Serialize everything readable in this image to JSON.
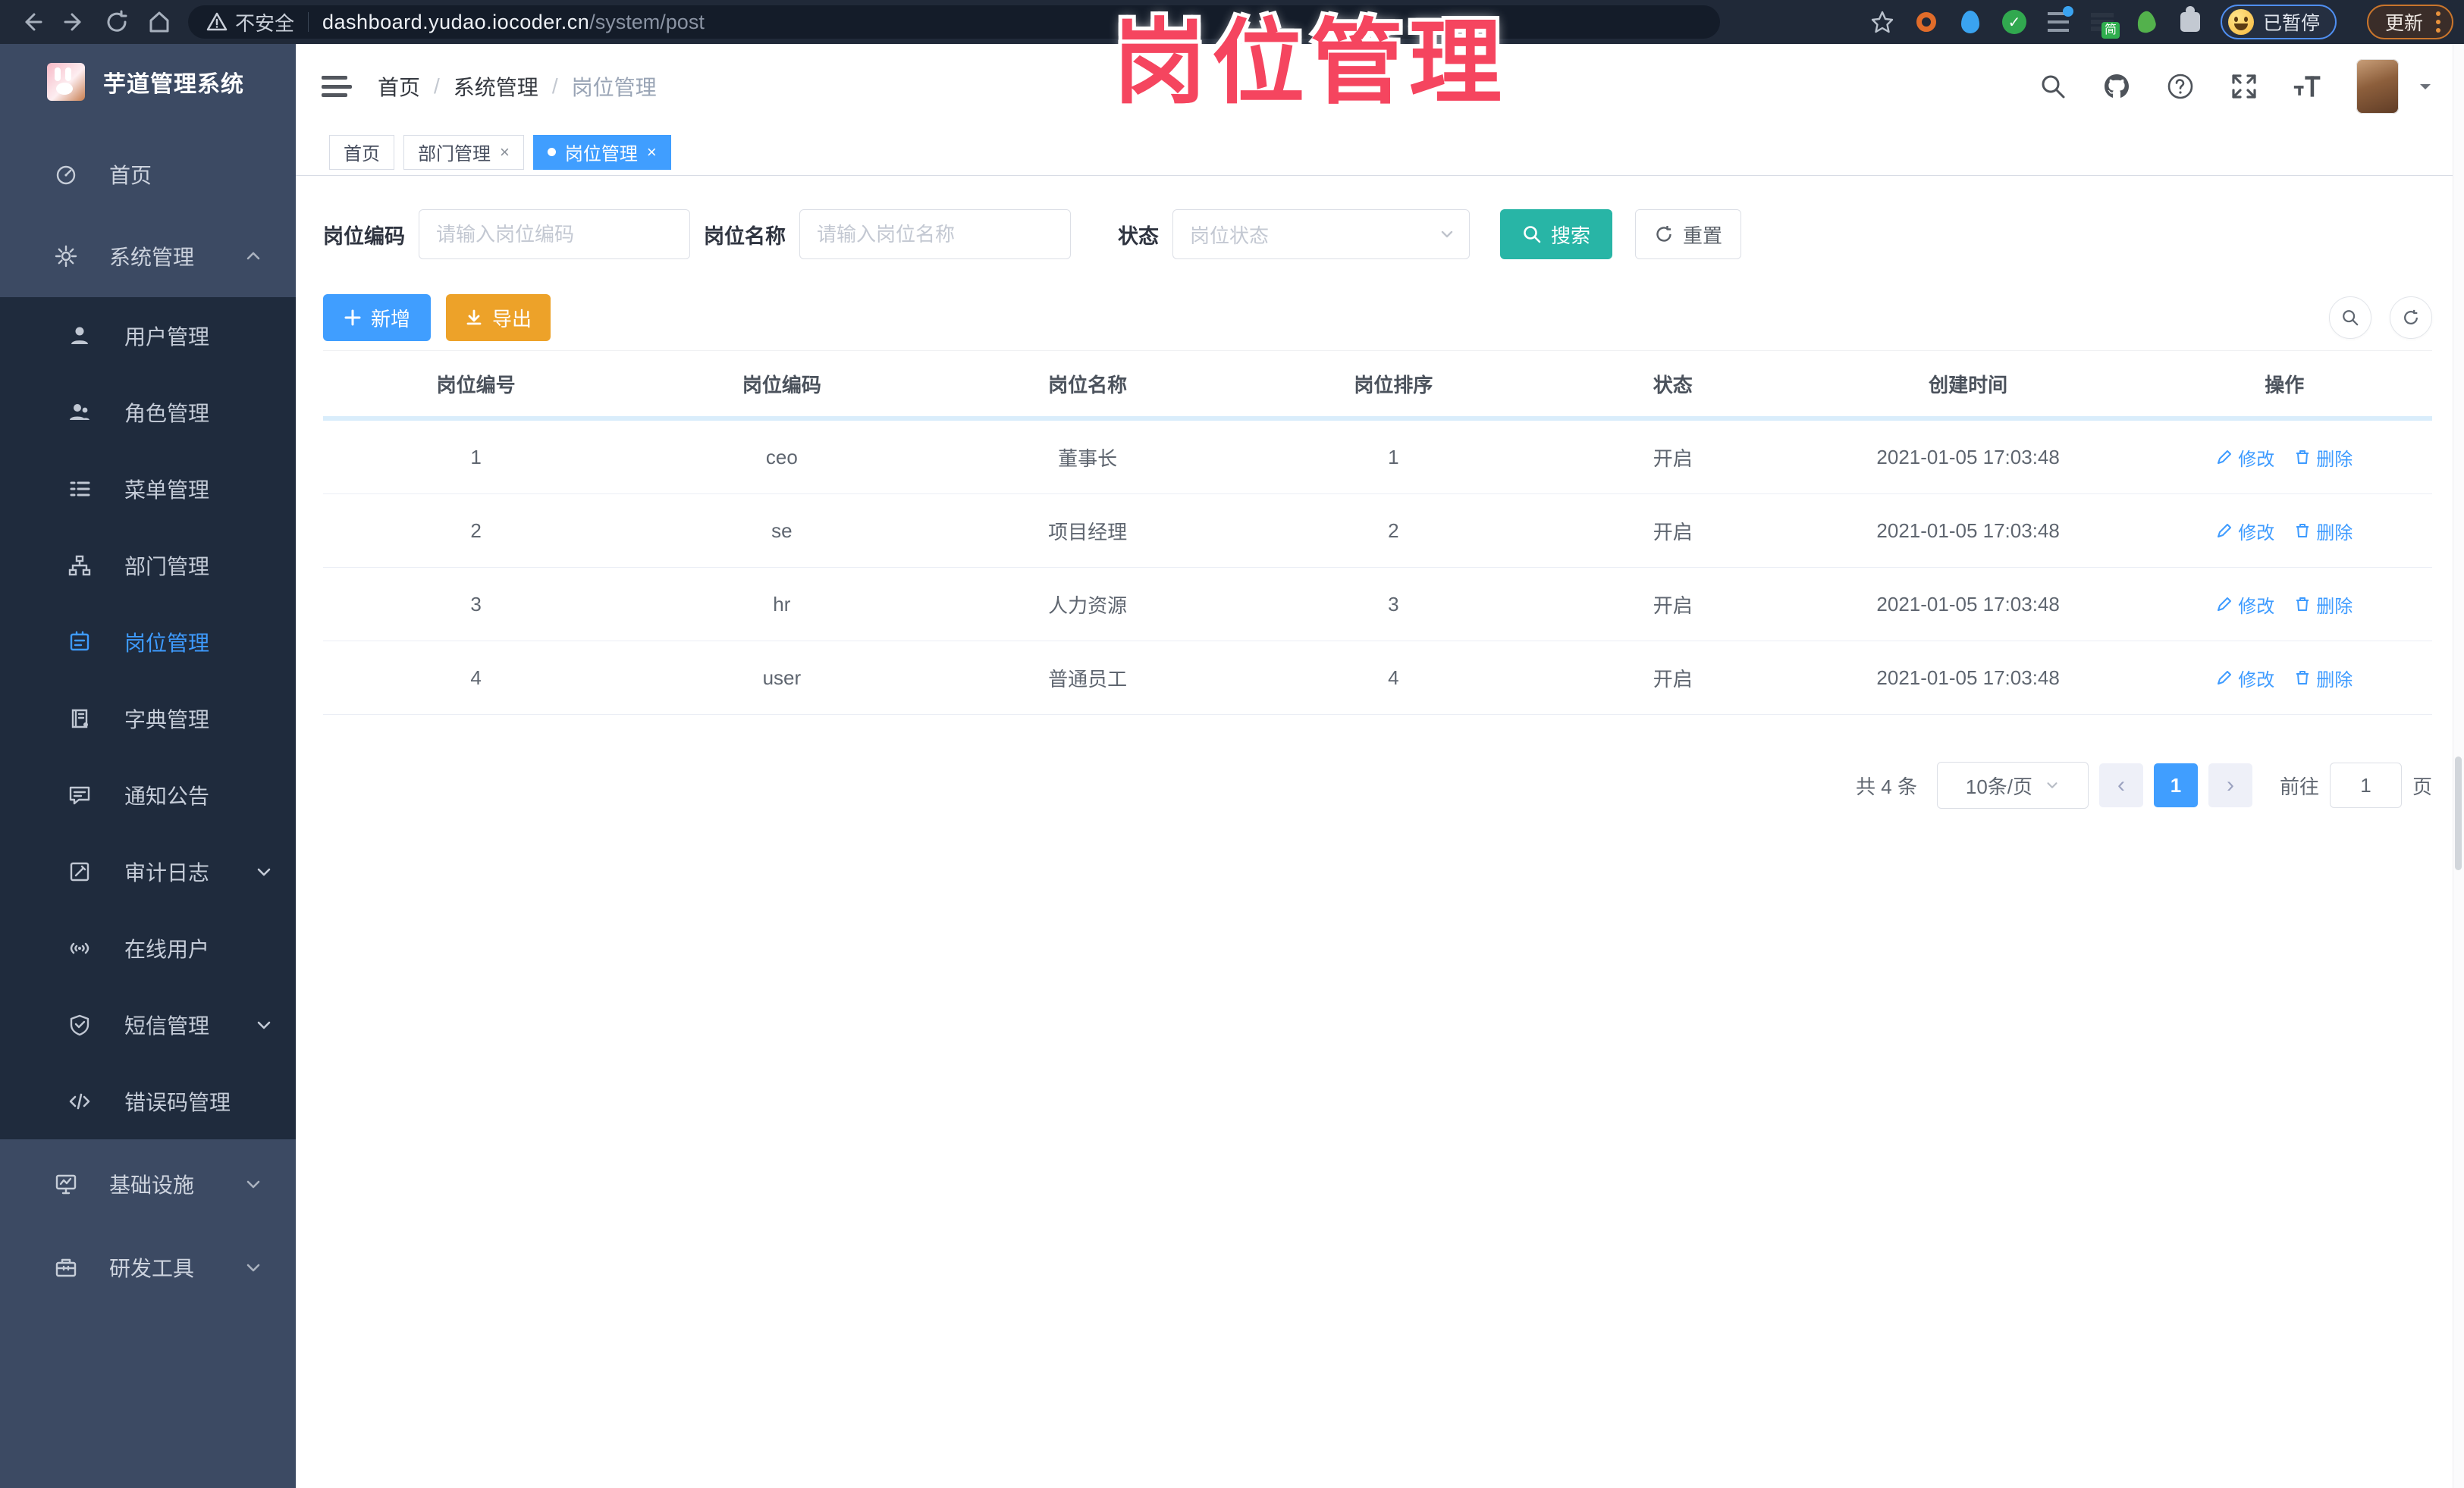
{
  "browser": {
    "security_label": "不安全",
    "url_host": "dashboard.yudao.iocoder.cn",
    "url_path": "/system/post",
    "extension_badge": "简",
    "paused_badge": "已暂停",
    "update_button": "更新"
  },
  "overlay_title": "岗位管理",
  "icons": {
    "close": "×",
    "crumb_separator": "/",
    "prev_arrow": "‹",
    "next_arrow": "›"
  },
  "sidebar": {
    "app_title": "芋道管理系统",
    "root": [
      {
        "label": "首页"
      },
      {
        "label": "系统管理"
      }
    ],
    "system_children": [
      {
        "label": "用户管理"
      },
      {
        "label": "角色管理"
      },
      {
        "label": "菜单管理"
      },
      {
        "label": "部门管理"
      },
      {
        "label": "岗位管理"
      },
      {
        "label": "字典管理"
      },
      {
        "label": "通知公告"
      },
      {
        "label": "审计日志"
      },
      {
        "label": "在线用户"
      },
      {
        "label": "短信管理"
      },
      {
        "label": "错误码管理"
      }
    ],
    "bottom": [
      {
        "label": "基础设施"
      },
      {
        "label": "研发工具"
      }
    ]
  },
  "header": {
    "breadcrumb": [
      {
        "label": "首页"
      },
      {
        "label": "系统管理"
      },
      {
        "label": "岗位管理"
      }
    ]
  },
  "tabs": [
    {
      "label": "首页"
    },
    {
      "label": "部门管理"
    },
    {
      "label": "岗位管理"
    }
  ],
  "filter": {
    "code_label": "岗位编码",
    "code_placeholder": "请输入岗位编码",
    "name_label": "岗位名称",
    "name_placeholder": "请输入岗位名称",
    "status_label": "状态",
    "status_placeholder": "岗位状态",
    "search_label": "搜索",
    "reset_label": "重置"
  },
  "toolbar": {
    "add_label": "新增",
    "export_label": "导出"
  },
  "table": {
    "headers": [
      "岗位编号",
      "岗位编码",
      "岗位名称",
      "岗位排序",
      "状态",
      "创建时间",
      "操作"
    ],
    "edit_label": "修改",
    "delete_label": "删除",
    "rows": [
      {
        "id": "1",
        "code": "ceo",
        "name": "董事长",
        "sort": "1",
        "status": "开启",
        "created": "2021-01-05 17:03:48"
      },
      {
        "id": "2",
        "code": "se",
        "name": "项目经理",
        "sort": "2",
        "status": "开启",
        "created": "2021-01-05 17:03:48"
      },
      {
        "id": "3",
        "code": "hr",
        "name": "人力资源",
        "sort": "3",
        "status": "开启",
        "created": "2021-01-05 17:03:48"
      },
      {
        "id": "4",
        "code": "user",
        "name": "普通员工",
        "sort": "4",
        "status": "开启",
        "created": "2021-01-05 17:03:48"
      }
    ]
  },
  "pagination": {
    "total_text": "共 4 条",
    "page_size": "10条/页",
    "current_page": "1",
    "jump_prefix": "前往",
    "jump_value": "1",
    "jump_suffix": "页"
  },
  "colors": {
    "primary": "#409eff",
    "search_teal": "#28b5a6",
    "export_orange": "#eda229",
    "overlay_pink": "#f5455f",
    "sidebar_bg": "#3c4a63",
    "submenu_bg": "#1f2b3d"
  }
}
